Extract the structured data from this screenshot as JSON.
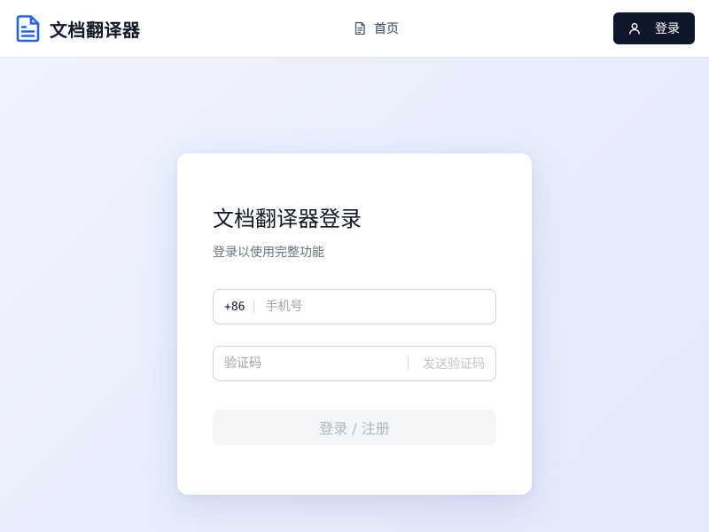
{
  "header": {
    "brand_title": "文档翻译器",
    "nav_home": "首页",
    "login_label": "登录"
  },
  "card": {
    "title": "文档翻译器登录",
    "subtitle": "登录以使用完整功能",
    "phone": {
      "prefix": "+86",
      "placeholder": "手机号",
      "value": ""
    },
    "code": {
      "placeholder": "验证码",
      "value": "",
      "send_label": "发送验证码"
    },
    "submit_label": "登录 / 注册"
  },
  "colors": {
    "brand_icon": "#2563eb",
    "header_button_bg": "#0f172a",
    "disabled_button_bg": "#f5f6f8"
  },
  "icons": {
    "brand": "document-icon",
    "nav_home": "file-text-icon",
    "login": "user-icon"
  }
}
